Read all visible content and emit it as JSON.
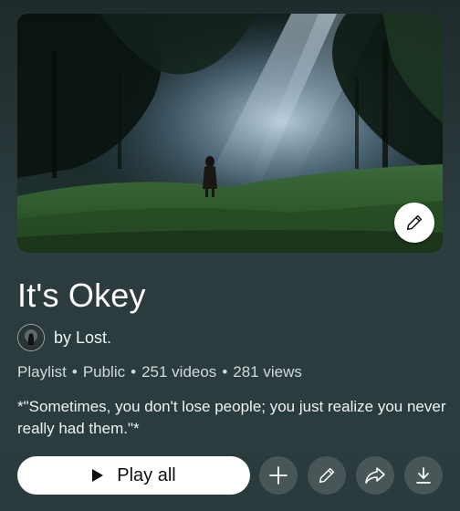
{
  "playlist": {
    "title": "It's Okey",
    "owner": "by Lost.",
    "meta": {
      "type": "Playlist",
      "visibility": "Public",
      "videos": "251 videos",
      "views": "281 views"
    },
    "description": "*\"Sometimes, you don't lose people; you just realize you never really had them.\"*"
  },
  "actions": {
    "play_all_label": "Play all"
  },
  "icons": {
    "edit_cover": "pencil-icon",
    "play": "play-icon",
    "add": "plus-icon",
    "edit": "pencil-icon",
    "share": "share-arrow-icon",
    "download": "download-icon"
  },
  "colors": {
    "background": "#2a3a3c",
    "primary_button": "#ffffff",
    "secondary_button": "rgba(255,255,255,0.14)",
    "text_secondary": "#d3d9da"
  }
}
